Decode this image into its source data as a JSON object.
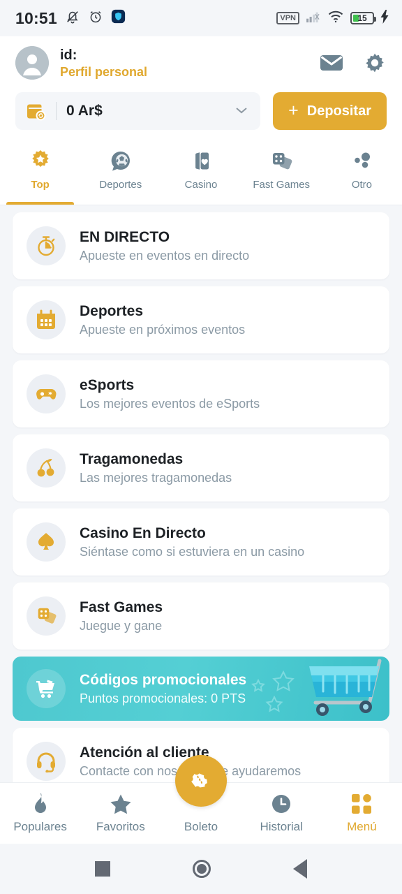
{
  "statusbar": {
    "time": "10:51",
    "icons_left": [
      "bell-muted-icon",
      "alarm-clock-icon",
      "shield-icon"
    ],
    "vpn_label": "VPN",
    "battery_percent": "15",
    "icons_right": [
      "signal-icon",
      "wifi-icon",
      "battery-icon",
      "charging-bolt-icon"
    ]
  },
  "header": {
    "avatar_icon": "user-avatar-icon",
    "id_label": "id:",
    "profile_link": "Perfil personal",
    "mail_icon": "envelope-icon",
    "settings_icon": "gear-icon",
    "balance": {
      "wallet_icon": "wallet-icon",
      "amount": "0 Ar$",
      "chevron": "chevron-down-icon"
    },
    "deposit_button": {
      "plus": "+",
      "label": "Depositar"
    }
  },
  "tabs": [
    {
      "label": "Top",
      "icon": "star-badge-icon",
      "active": true
    },
    {
      "label": "Deportes",
      "icon": "soccer-bubble-icon",
      "active": false
    },
    {
      "label": "Casino",
      "icon": "cards-heart-icon",
      "active": false
    },
    {
      "label": "Fast Games",
      "icon": "dice-icon",
      "active": false
    },
    {
      "label": "Otro",
      "icon": "dots-icon",
      "active": false
    }
  ],
  "list": [
    {
      "icon": "stopwatch-icon",
      "title": "EN DIRECTO",
      "subtitle": "Apueste en eventos en directo"
    },
    {
      "icon": "calendar-icon",
      "title": "Deportes",
      "subtitle": "Apueste en próximos eventos"
    },
    {
      "icon": "gamepad-icon",
      "title": "eSports",
      "subtitle": "Los mejores eventos de eSports"
    },
    {
      "icon": "cherries-icon",
      "title": "Tragamonedas",
      "subtitle": "Las mejores tragamonedas"
    },
    {
      "icon": "spade-icon",
      "title": "Casino En Directo",
      "subtitle": "Siéntase como si estuviera en un casino"
    },
    {
      "icon": "dice-icon",
      "title": "Fast Games",
      "subtitle": "Juegue y gane"
    }
  ],
  "promo": {
    "icon": "shopping-cart-icon",
    "title": "Códigos promocionales",
    "subtitle": "Puntos promocionales: 0 PTS",
    "art": "shopping-cart-illustration"
  },
  "support": {
    "icon": "headset-icon",
    "title": "Atención al cliente",
    "subtitle": "Contacte con nosotros y le ayudaremos"
  },
  "bottom_nav": [
    {
      "label": "Populares",
      "icon": "flame-icon",
      "active": false
    },
    {
      "label": "Favoritos",
      "icon": "star-icon",
      "active": false
    },
    {
      "label": "Boleto",
      "icon": "ticket-icon",
      "active": false
    },
    {
      "label": "Historial",
      "icon": "clock-icon",
      "active": false
    },
    {
      "label": "Menú",
      "icon": "grid-icon",
      "active": true
    }
  ],
  "android_nav": [
    "recents-square-icon",
    "home-circle-icon",
    "back-triangle-icon"
  ],
  "colors": {
    "gold": "#e3ab32",
    "slate": "#6b8290",
    "teal": "#4ec8cf",
    "page_bg": "#f4f6f9"
  }
}
